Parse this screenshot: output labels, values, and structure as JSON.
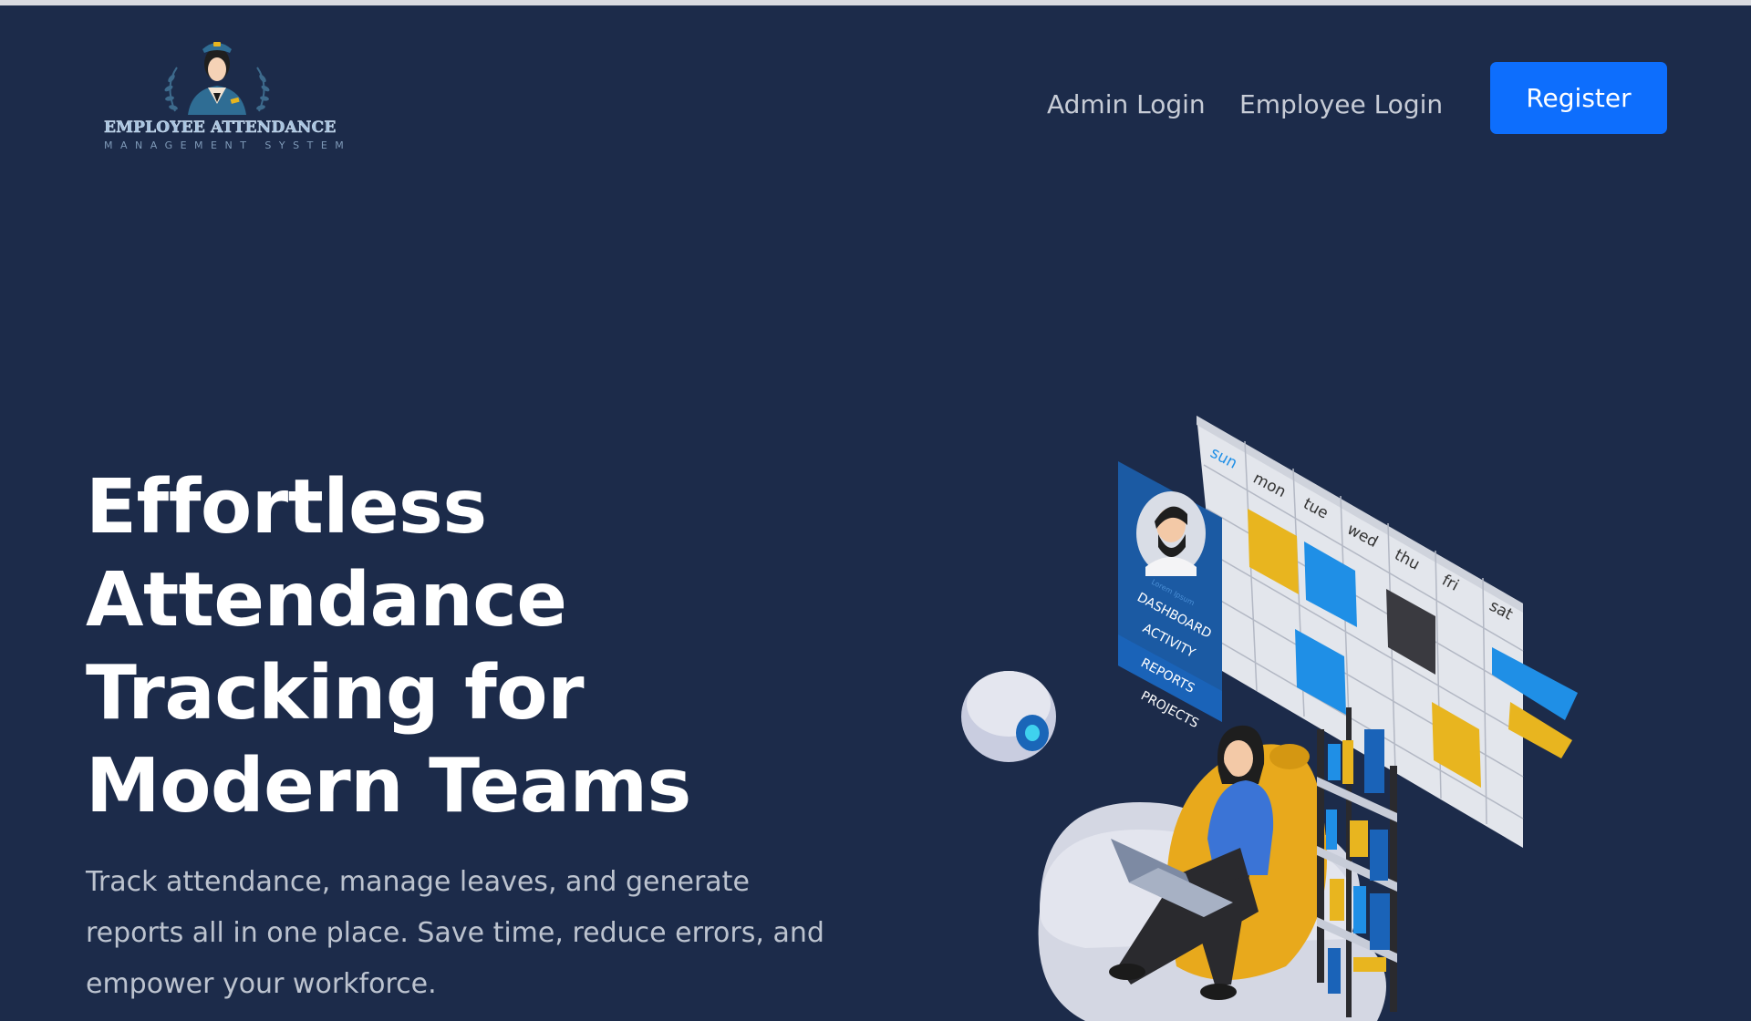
{
  "brand": {
    "title": "EMPLOYEE ATTENDANCE",
    "subtitle": "MANAGEMENT SYSTEM"
  },
  "nav": {
    "admin_login": "Admin Login",
    "employee_login": "Employee Login",
    "register": "Register"
  },
  "hero": {
    "headline_lines": [
      "Effortless",
      "Attendance",
      "Tracking for",
      "Modern Teams"
    ],
    "subtext": "Track attendance, manage leaves, and generate reports all in one place. Save time, reduce errors, and empower your workforce."
  },
  "illustration": {
    "calendar_days": [
      "sun",
      "mon",
      "tue",
      "wed",
      "thu",
      "fri",
      "sat"
    ],
    "profile_name": "Lorem Ipsum",
    "menu_items": [
      "DASHBOARD",
      "ACTIVITY",
      "REPORTS",
      "PROJECTS"
    ]
  },
  "colors": {
    "background": "#1c2b4a",
    "accent": "#0d6efd",
    "sticky_yellow": "#e8b51f",
    "sticky_blue": "#1f8fe6"
  }
}
